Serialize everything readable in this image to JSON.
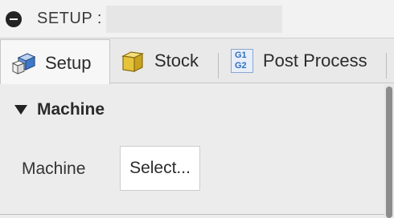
{
  "header": {
    "title": "SETUP :",
    "name_value": "",
    "collapse_icon": "minus-circle-icon"
  },
  "tabs": [
    {
      "label": "Setup",
      "icon": "setup-cube-icon",
      "active": true
    },
    {
      "label": "Stock",
      "icon": "stock-cube-icon",
      "active": false
    },
    {
      "label": "Post Process",
      "icon": "gcode-icon",
      "active": false,
      "icon_text_top": "G1",
      "icon_text_bottom": "G2"
    }
  ],
  "section": {
    "title": "Machine",
    "expanded": true
  },
  "machine_field": {
    "label": "Machine",
    "button_label": "Select..."
  },
  "colors": {
    "background": "#eeeeee",
    "stock_yellow": "#e6c43a",
    "setup_blue": "#5b8fd6",
    "gcode_blue": "#2f6fc0"
  }
}
